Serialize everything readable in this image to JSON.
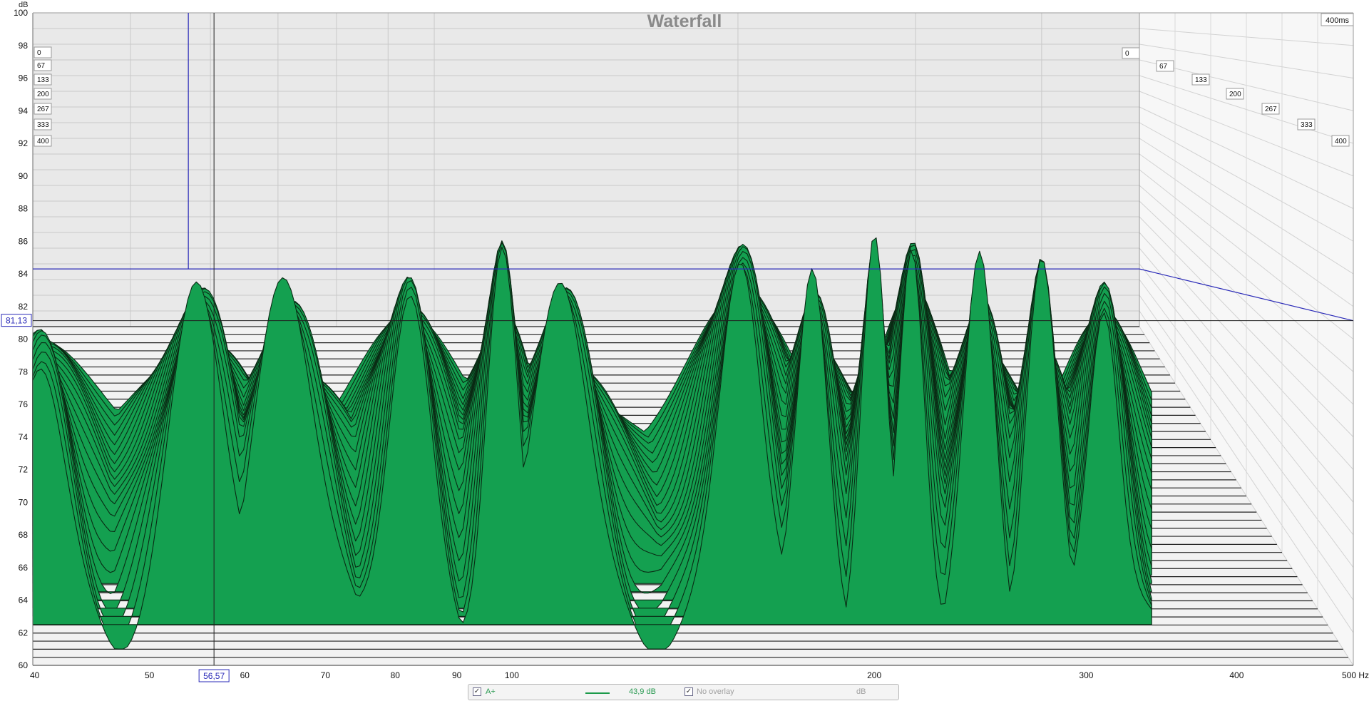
{
  "window": {
    "title": "Waterfall"
  },
  "cursor": {
    "y_readout": "81,13",
    "x_readout": "56,57",
    "y_value": 81.13,
    "x_value": 56.57
  },
  "legend": {
    "item1_checked": "✓",
    "item1_label": "A+",
    "item1_value": "43,9 dB",
    "item2_checked": "✓",
    "item2_label": "No overlay",
    "item2_unit": "dB",
    "line_color": "#1c9a4a"
  },
  "chart_data": {
    "type": "waterfall",
    "title": "Waterfall",
    "y_axis_unit": "dB",
    "x_axis_unit": "Hz",
    "x_scale": "log",
    "xlim": [
      40,
      500
    ],
    "ylim": [
      60,
      100
    ],
    "y_ticks": [
      "60",
      "62",
      "64",
      "66",
      "68",
      "70",
      "72",
      "74",
      "76",
      "78",
      "80",
      "82",
      "84",
      "86",
      "88",
      "90",
      "92",
      "94",
      "96",
      "98",
      "100"
    ],
    "x_ticks": [
      {
        "value": 40,
        "label": "40"
      },
      {
        "value": 50,
        "label": "50"
      },
      {
        "value": 60,
        "label": "60"
      },
      {
        "value": 70,
        "label": "70"
      },
      {
        "value": 80,
        "label": "80"
      },
      {
        "value": 90,
        "label": "90"
      },
      {
        "value": 100,
        "label": "100"
      },
      {
        "value": 200,
        "label": "200"
      },
      {
        "value": 300,
        "label": "300"
      },
      {
        "value": 400,
        "label": "400"
      },
      {
        "value": 500,
        "label": "500 Hz"
      }
    ],
    "time_axis_max_label": "400ms",
    "time_slices": [
      "0",
      "67",
      "133",
      "200",
      "267",
      "333",
      "400"
    ],
    "fill_color": "#14a050",
    "outline_color": "#0a2a14",
    "peaks": [
      {
        "f": 40.5,
        "db": 79.5,
        "w": 0.045
      },
      {
        "f": 55.0,
        "db": 84.2,
        "w": 0.05
      },
      {
        "f": 65.0,
        "db": 84.3,
        "w": 0.055
      },
      {
        "f": 82.0,
        "db": 83.0,
        "w": 0.04
      },
      {
        "f": 98.0,
        "db": 85.6,
        "w": 0.03
      },
      {
        "f": 110.0,
        "db": 84.7,
        "w": 0.05
      },
      {
        "f": 155.0,
        "db": 86.0,
        "w": 0.04
      },
      {
        "f": 178.0,
        "db": 84.4,
        "w": 0.03
      },
      {
        "f": 200.0,
        "db": 85.1,
        "w": 0.025
      },
      {
        "f": 215.0,
        "db": 86.5,
        "w": 0.025
      },
      {
        "f": 245.0,
        "db": 84.5,
        "w": 0.03
      },
      {
        "f": 275.0,
        "db": 84.3,
        "w": 0.03
      },
      {
        "f": 310.0,
        "db": 83.0,
        "w": 0.03
      }
    ]
  }
}
